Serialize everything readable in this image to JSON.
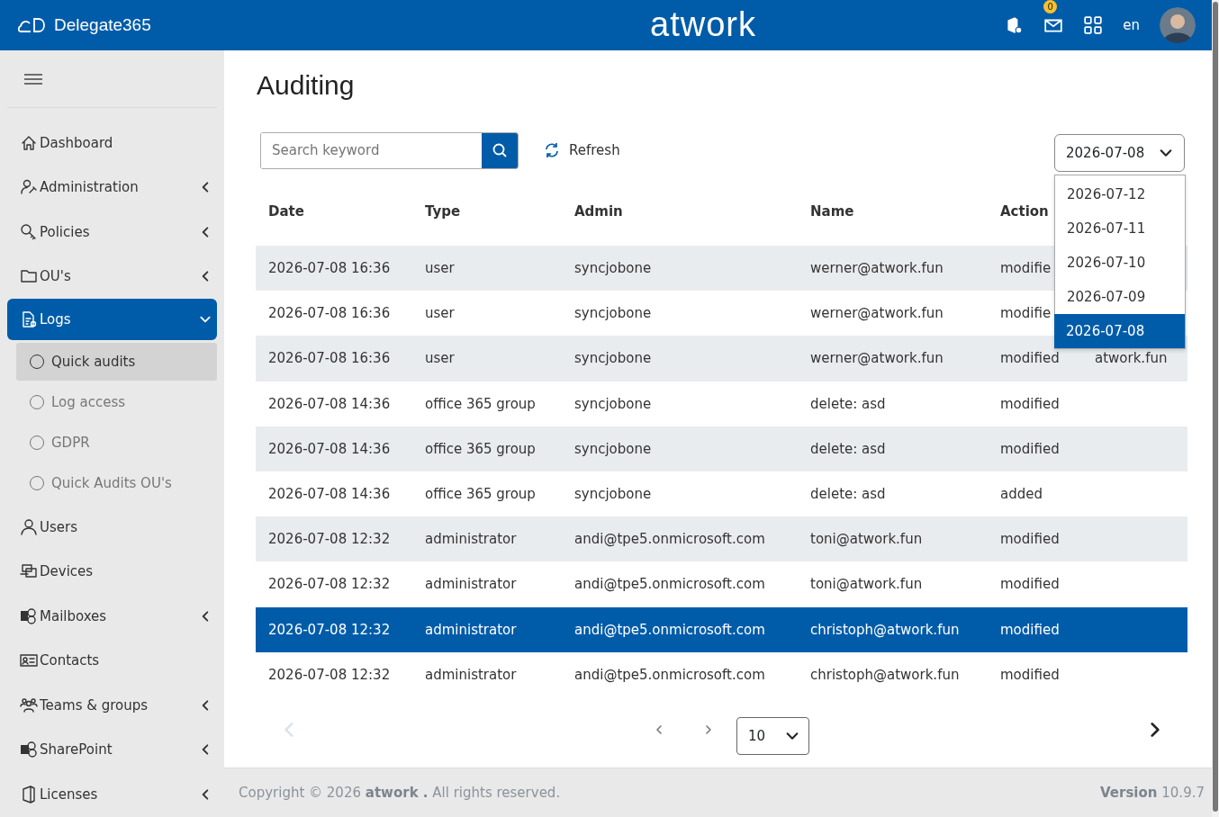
{
  "header": {
    "app_name": "Delegate365",
    "brand": "atwork",
    "mail_badge": "0",
    "language": "en"
  },
  "sidebar": {
    "items": [
      {
        "label": "Dashboard",
        "kind": "link",
        "selected": false
      },
      {
        "label": "Administration",
        "kind": "group",
        "expanded": false,
        "selected": false
      },
      {
        "label": "Policies",
        "kind": "group",
        "expanded": false,
        "selected": false
      },
      {
        "label": "OU's",
        "kind": "group",
        "expanded": false,
        "selected": false
      },
      {
        "label": "Logs",
        "kind": "group",
        "expanded": true,
        "selected": true,
        "children": [
          {
            "label": "Quick audits",
            "selected": true
          },
          {
            "label": "Log access",
            "selected": false
          },
          {
            "label": "GDPR",
            "selected": false
          },
          {
            "label": "Quick Audits OU's",
            "selected": false
          }
        ]
      },
      {
        "label": "Users",
        "kind": "link",
        "selected": false
      },
      {
        "label": "Devices",
        "kind": "link",
        "selected": false
      },
      {
        "label": "Mailboxes",
        "kind": "group",
        "expanded": false,
        "selected": false
      },
      {
        "label": "Contacts",
        "kind": "link",
        "selected": false
      },
      {
        "label": "Teams & groups",
        "kind": "group",
        "expanded": false,
        "selected": false
      },
      {
        "label": "SharePoint",
        "kind": "group",
        "expanded": false,
        "selected": false
      },
      {
        "label": "Licenses",
        "kind": "group",
        "expanded": false,
        "selected": false
      }
    ]
  },
  "page": {
    "title": "Auditing",
    "search": {
      "placeholder": "Search keyword"
    },
    "refresh_label": "Refresh",
    "date_select": {
      "value": "2026-07-08",
      "expanded": true,
      "options": [
        {
          "label": "2026-07-12",
          "selected": false
        },
        {
          "label": "2026-07-11",
          "selected": false
        },
        {
          "label": "2026-07-10",
          "selected": false
        },
        {
          "label": "2026-07-09",
          "selected": false
        },
        {
          "label": "2026-07-08",
          "selected": true
        }
      ]
    }
  },
  "table": {
    "columns": [
      "Date",
      "Type",
      "Admin",
      "Name",
      "Action"
    ],
    "rows": [
      {
        "cells": [
          "2026-07-08 16:36",
          "user",
          "syncjobone",
          "werner@atwork.fun",
          "modifie"
        ],
        "selected": false
      },
      {
        "cells": [
          "2026-07-08 16:36",
          "user",
          "syncjobone",
          "werner@atwork.fun",
          "modifie"
        ],
        "selected": false
      },
      {
        "cells": [
          "2026-07-08 16:36",
          "user",
          "syncjobone",
          "werner@atwork.fun",
          "modified",
          "atwork.fun"
        ],
        "selected": false
      },
      {
        "cells": [
          "2026-07-08 14:36",
          "office 365 group",
          "syncjobone",
          "delete: asd",
          "modified"
        ],
        "selected": false
      },
      {
        "cells": [
          "2026-07-08 14:36",
          "office 365 group",
          "syncjobone",
          "delete: asd",
          "modified"
        ],
        "selected": false
      },
      {
        "cells": [
          "2026-07-08 14:36",
          "office 365 group",
          "syncjobone",
          "delete: asd",
          "added"
        ],
        "selected": false
      },
      {
        "cells": [
          "2026-07-08 12:32",
          "administrator",
          "andi@tpe5.onmicrosoft.com",
          "toni@atwork.fun",
          "modified"
        ],
        "selected": false
      },
      {
        "cells": [
          "2026-07-08 12:32",
          "administrator",
          "andi@tpe5.onmicrosoft.com",
          "toni@atwork.fun",
          "modified"
        ],
        "selected": false
      },
      {
        "cells": [
          "2026-07-08 12:32",
          "administrator",
          "andi@tpe5.onmicrosoft.com",
          "christoph@atwork.fun",
          "modified"
        ],
        "selected": true
      },
      {
        "cells": [
          "2026-07-08 12:32",
          "administrator",
          "andi@tpe5.onmicrosoft.com",
          "christoph@atwork.fun",
          "modified"
        ],
        "selected": false
      }
    ]
  },
  "pagination": {
    "page_size": "10",
    "first_disabled": true
  },
  "footer": {
    "copyright": "Copyright © 2026 **atwork .** All rights reserved.",
    "version_label": "Version",
    "version": "10.9.7"
  }
}
